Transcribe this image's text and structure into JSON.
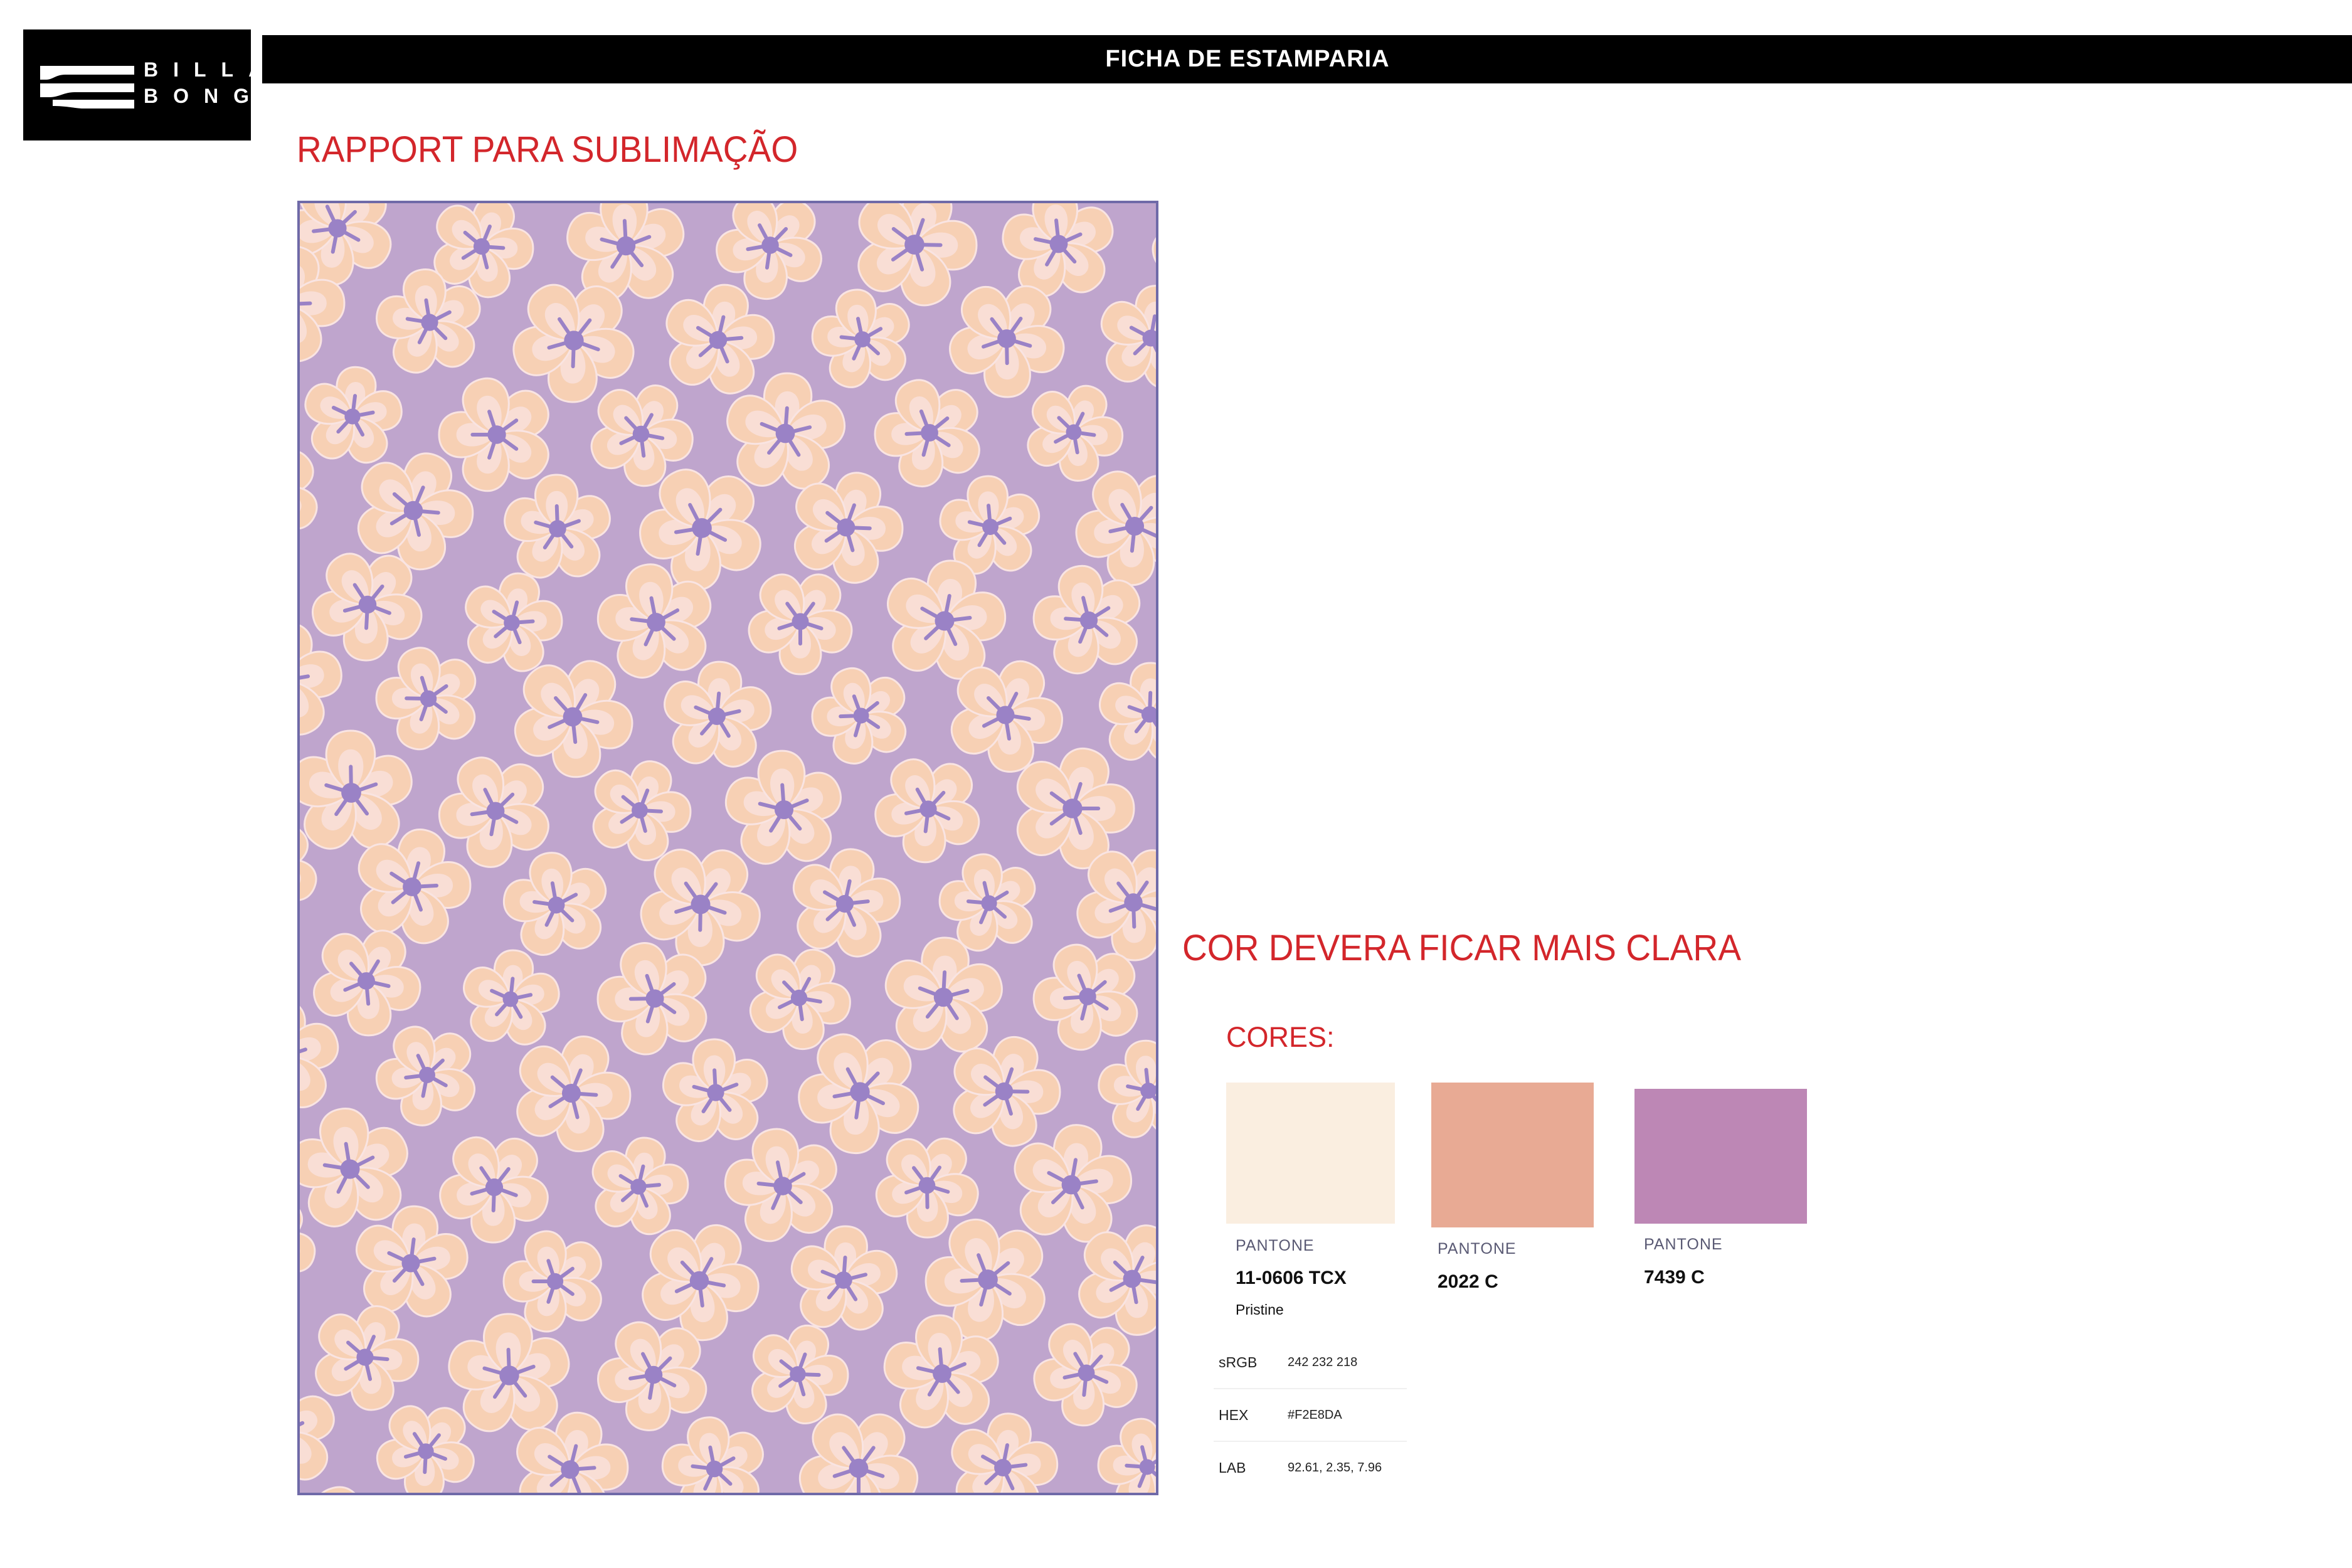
{
  "logo": {
    "line1": "BILLA",
    "line2": "BONG"
  },
  "header": {
    "title": "FICHA DE ESTAMPARIA"
  },
  "section_rapport": "RAPPORT PARA SUBLIMAÇÃO",
  "note": "COR DEVERA FICAR MAIS CLARA",
  "cores_label": "CORES:",
  "pattern": {
    "background": "#bfa5cd",
    "petal": "#f7d0b4",
    "highlight": "#f9e4e2",
    "center": "#9a82c6"
  },
  "swatches": [
    {
      "color": "#faeee0",
      "label": "PANTONE",
      "code": "11-0606 TCX",
      "name": "Pristine"
    },
    {
      "color": "#e8aa94",
      "label": "PANTONE",
      "code": "2022 C"
    },
    {
      "color": "#bd87b5",
      "label": "PANTONE",
      "code": "7439 C"
    }
  ],
  "color_info": [
    {
      "key": "sRGB",
      "value": "242 232 218"
    },
    {
      "key": "HEX",
      "value": "#F2E8DA"
    },
    {
      "key": "LAB",
      "value": "92.61, 2.35, 7.96"
    }
  ]
}
